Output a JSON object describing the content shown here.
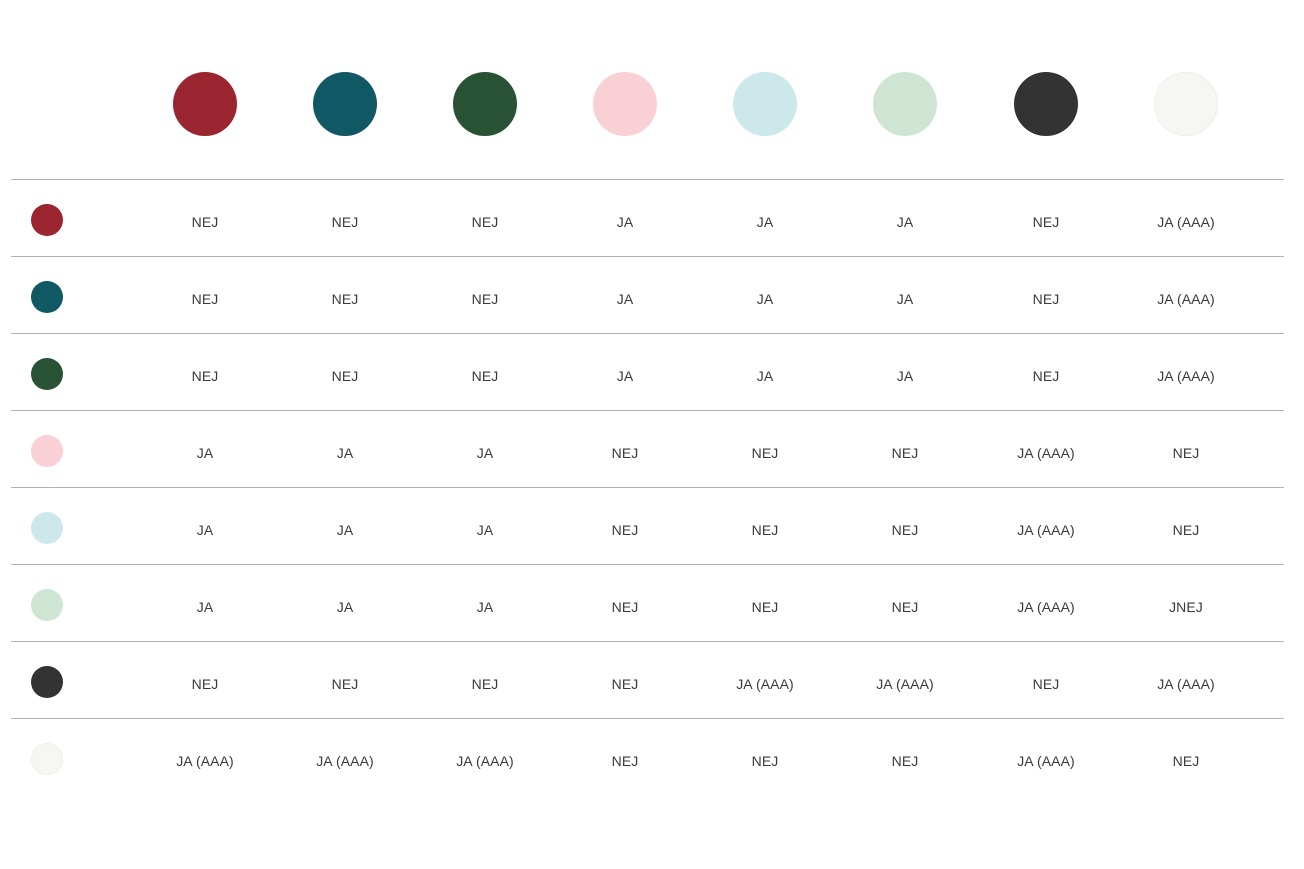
{
  "colors": [
    {
      "hex": "#9a242f"
    },
    {
      "hex": "#0f5864"
    },
    {
      "hex": "#285233"
    },
    {
      "hex": "#f8d0d5"
    },
    {
      "hex": "#cce8eb"
    },
    {
      "hex": "#cfe5d3"
    },
    {
      "hex": "#333333"
    },
    {
      "hex": "#f6f7f3"
    }
  ],
  "rows": [
    {
      "cells": [
        "NEJ",
        "NEJ",
        "NEJ",
        "JA",
        "JA",
        "JA",
        "NEJ",
        "JA (AAA)"
      ]
    },
    {
      "cells": [
        "NEJ",
        "NEJ",
        "NEJ",
        "JA",
        "JA",
        "JA",
        "NEJ",
        "JA (AAA)"
      ]
    },
    {
      "cells": [
        "NEJ",
        "NEJ",
        "NEJ",
        "JA",
        "JA",
        "JA",
        "NEJ",
        "JA (AAA)"
      ]
    },
    {
      "cells": [
        "JA",
        "JA",
        "JA",
        "NEJ",
        "NEJ",
        "NEJ",
        "JA (AAA)",
        "NEJ"
      ]
    },
    {
      "cells": [
        "JA",
        "JA",
        "JA",
        "NEJ",
        "NEJ",
        "NEJ",
        "JA (AAA)",
        "NEJ"
      ]
    },
    {
      "cells": [
        "JA",
        "JA",
        "JA",
        "NEJ",
        "NEJ",
        "NEJ",
        "JA (AAA)",
        "JNEJ"
      ]
    },
    {
      "cells": [
        "NEJ",
        "NEJ",
        "NEJ",
        "NEJ",
        "JA (AAA)",
        "JA (AAA)",
        "NEJ",
        "JA (AAA)"
      ]
    },
    {
      "cells": [
        "JA (AAA)",
        "JA (AAA)",
        "JA (AAA)",
        "NEJ",
        "NEJ",
        "NEJ",
        "JA (AAA)",
        "NEJ"
      ]
    }
  ]
}
